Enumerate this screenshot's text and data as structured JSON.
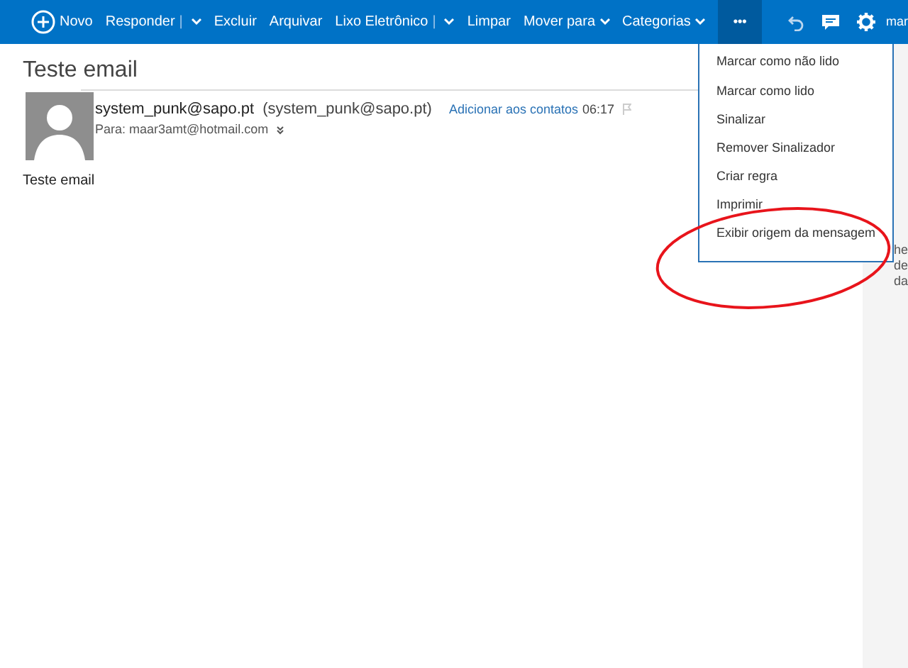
{
  "toolbar": {
    "items": [
      {
        "kind": "new",
        "label": "Novo"
      },
      {
        "kind": "split",
        "label": "Responder",
        "separator": "|"
      },
      {
        "kind": "button",
        "label": "Excluir"
      },
      {
        "kind": "button",
        "label": "Arquivar"
      },
      {
        "kind": "split",
        "label": "Lixo Eletrônico",
        "separator": "|"
      },
      {
        "kind": "button",
        "label": "Limpar"
      },
      {
        "kind": "dropdown",
        "label": "Mover para"
      },
      {
        "kind": "dropdown",
        "label": "Categorias"
      },
      {
        "kind": "more",
        "label": "•••",
        "selected": true
      }
    ],
    "account": "mar"
  },
  "message": {
    "subject": "Teste email",
    "sender": "system_punk@sapo.pt",
    "sender_address": "(system_punk@sapo.pt)",
    "add_contact": "Adicionar aos contatos",
    "time": "06:17",
    "to": "Para: maar3amt@hotmail.com",
    "body": "Teste email"
  },
  "menu": {
    "items": [
      "Marcar como não lido",
      "Marcar como lido",
      "Sinalizar",
      "Remover Sinalizador",
      "Criar regra",
      "Imprimir",
      "Exibir origem da mensagem"
    ]
  },
  "side_panel": {
    "lines": [
      "he",
      "de",
      "da"
    ]
  },
  "annotation": {
    "kind": "ellipse"
  }
}
